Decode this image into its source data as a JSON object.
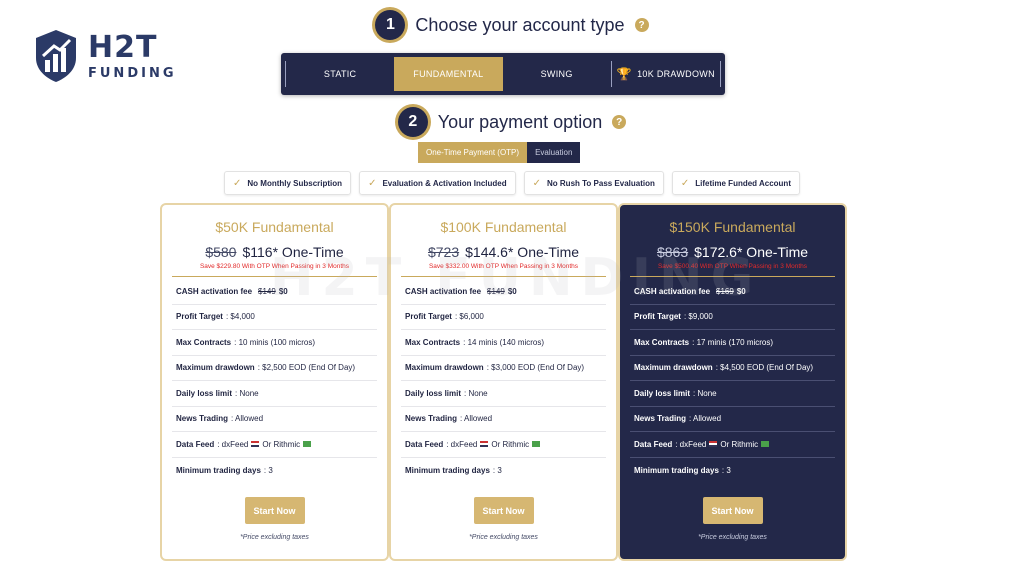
{
  "logo": {
    "main": "H2T",
    "sub": "FUNDING"
  },
  "step1": {
    "number": "1",
    "title": "Choose your account type"
  },
  "account_types": [
    "STATIC",
    "FUNDAMENTAL",
    "SWING",
    "10K DRAWDOWN"
  ],
  "active_account_type": "FUNDAMENTAL",
  "step2": {
    "number": "2",
    "title": "Your payment option"
  },
  "payment_options": {
    "otp": "One-Time Payment (OTP)",
    "evaluation": "Evaluation"
  },
  "features": [
    "No Monthly Subscription",
    "Evaluation & Activation Included",
    "No Rush To Pass Evaluation",
    "Lifetime Funded Account"
  ],
  "watermark": "H2T FUNDING",
  "plans": [
    {
      "title": "$50K Fundamental",
      "old_price": "$580",
      "new_price": "$116* One-Time",
      "save_note": "Save $229.80 With OTP When Passing in 3 Months",
      "cash_fee_label": "CASH activation fee",
      "cash_fee_old": "$149",
      "cash_fee_new": "$0",
      "profit_target_label": "Profit Target",
      "profit_target": ": $4,000",
      "max_contracts_label": "Max Contracts",
      "max_contracts": ": 10 minis (100 micros)",
      "max_drawdown_label": "Maximum drawdown",
      "max_drawdown": ": $2,500 EOD (End Of Day)",
      "daily_loss_label": "Daily loss limit",
      "daily_loss": ": None",
      "news_label": "News Trading",
      "news": ": Allowed",
      "data_feed_label": "Data Feed",
      "data_feed_a": ": dxFeed",
      "data_feed_b": "Or Rithmic",
      "min_days_label": "Minimum trading days",
      "min_days": ": 3",
      "button": "Start Now",
      "tax_note": "*Price excluding taxes"
    },
    {
      "title": "$100K Fundamental",
      "old_price": "$723",
      "new_price": "$144.6* One-Time",
      "save_note": "Save $332.00 With OTP When Passing in 3 Months",
      "cash_fee_label": "CASH activation fee",
      "cash_fee_old": "$149",
      "cash_fee_new": "$0",
      "profit_target_label": "Profit Target",
      "profit_target": ": $6,000",
      "max_contracts_label": "Max Contracts",
      "max_contracts": ": 14 minis (140 micros)",
      "max_drawdown_label": "Maximum drawdown",
      "max_drawdown": ": $3,000 EOD (End Of Day)",
      "daily_loss_label": "Daily loss limit",
      "daily_loss": ": None",
      "news_label": "News Trading",
      "news": ": Allowed",
      "data_feed_label": "Data Feed",
      "data_feed_a": ": dxFeed",
      "data_feed_b": "Or Rithmic",
      "min_days_label": "Minimum trading days",
      "min_days": ": 3",
      "button": "Start Now",
      "tax_note": "*Price excluding taxes"
    },
    {
      "title": "$150K Fundamental",
      "old_price": "$863",
      "new_price": "$172.6* One-Time",
      "save_note": "Save $500.40 With OTP When Passing in 3 Months",
      "cash_fee_label": "CASH activation fee",
      "cash_fee_old": "$169",
      "cash_fee_new": "$0",
      "profit_target_label": "Profit Target",
      "profit_target": ": $9,000",
      "max_contracts_label": "Max Contracts",
      "max_contracts": ": 17 minis (170 micros)",
      "max_drawdown_label": "Maximum drawdown",
      "max_drawdown": ": $4,500 EOD (End Of Day)",
      "daily_loss_label": "Daily loss limit",
      "daily_loss": ": None",
      "news_label": "News Trading",
      "news": ": Allowed",
      "data_feed_label": "Data Feed",
      "data_feed_a": ": dxFeed",
      "data_feed_b": "Or Rithmic",
      "min_days_label": "Minimum trading days",
      "min_days": ": 3",
      "button": "Start Now",
      "tax_note": "*Price excluding taxes"
    }
  ],
  "colors": {
    "navy": "#232849",
    "gold": "#c9a95c",
    "red": "#e22a2a"
  }
}
